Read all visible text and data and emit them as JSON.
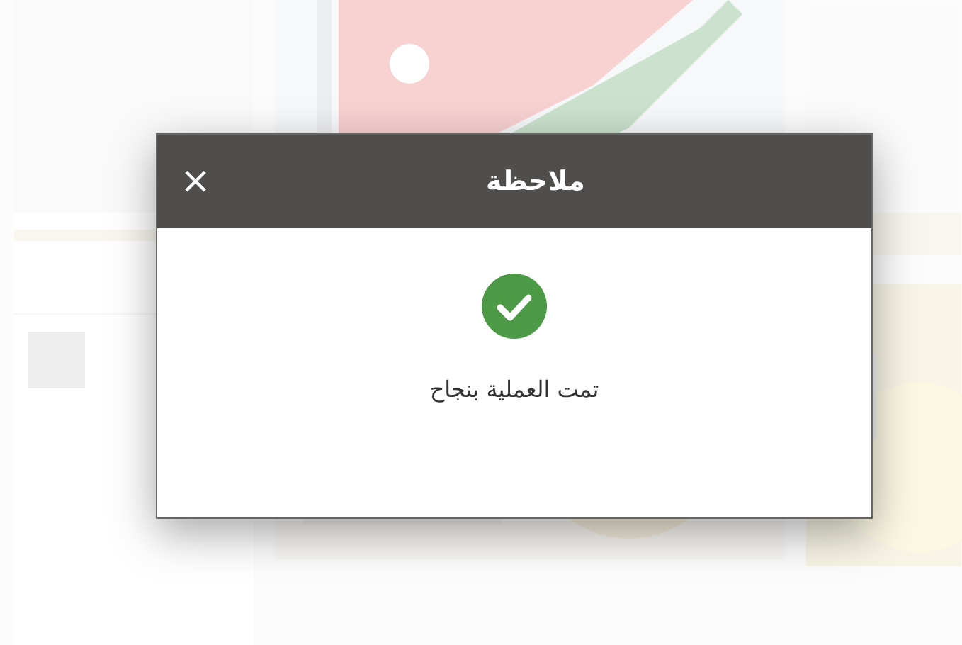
{
  "dialog": {
    "title": "ملاحظة",
    "close": "×",
    "status": {
      "kind": "success"
    },
    "message": "تمت العملية بنجاح"
  }
}
